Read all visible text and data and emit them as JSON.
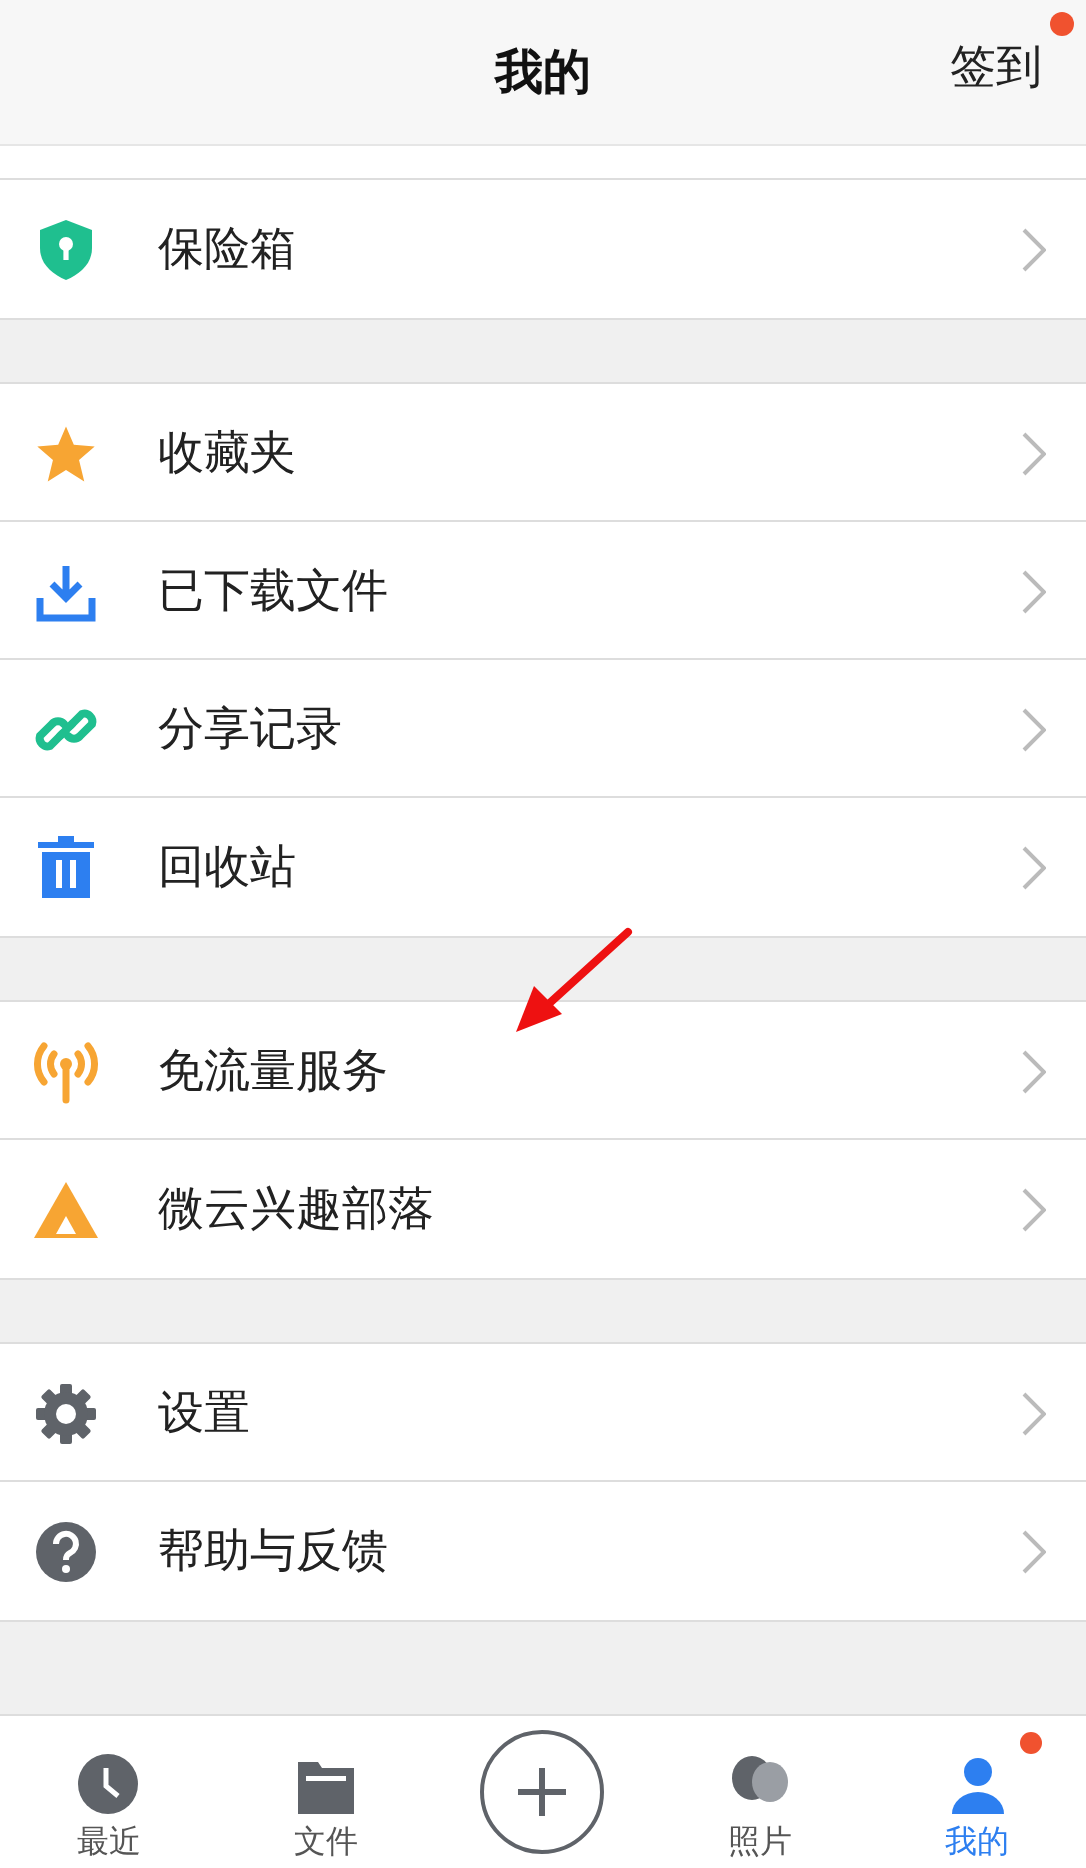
{
  "header": {
    "title": "我的",
    "action": {
      "label": "签到",
      "dot": true
    }
  },
  "sections": [
    {
      "items": [
        {
          "label": "保险箱"
        }
      ]
    },
    {
      "items": [
        {
          "label": "收藏夹"
        },
        {
          "label": "已下载文件"
        },
        {
          "label": "分享记录"
        },
        {
          "label": "回收站"
        }
      ]
    },
    {
      "items": [
        {
          "label": "免流量服务"
        },
        {
          "label": "微云兴趣部落"
        }
      ]
    },
    {
      "items": [
        {
          "label": "设置"
        },
        {
          "label": "帮助与反馈"
        }
      ]
    }
  ],
  "annotation": {
    "kind": "arrow"
  },
  "tab_bar": [
    {
      "kind": "tab",
      "label": "最近",
      "selected": false,
      "dot": false
    },
    {
      "kind": "tab",
      "label": "文件",
      "selected": false,
      "dot": false
    },
    {
      "kind": "add"
    },
    {
      "kind": "tab",
      "label": "照片",
      "selected": false,
      "dot": false
    },
    {
      "kind": "tab",
      "label": "我的",
      "selected": true,
      "dot": true
    }
  ]
}
